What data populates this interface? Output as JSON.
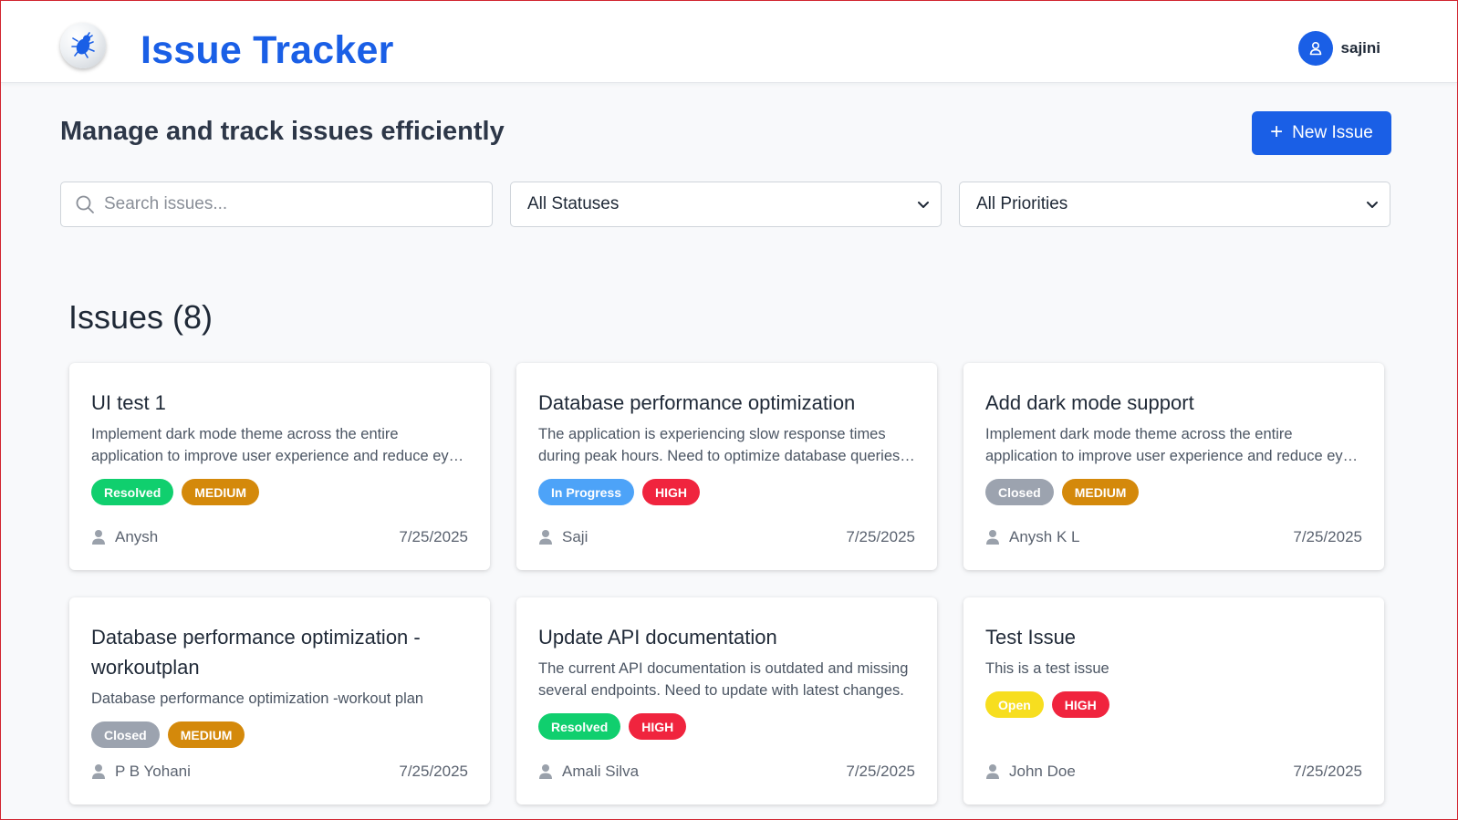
{
  "header": {
    "title": "Issue Tracker",
    "username": "sajini"
  },
  "toolbar": {
    "subtitle": "Manage and track issues efficiently",
    "new_issue_label": "New Issue",
    "search_placeholder": "Search issues...",
    "status_filter": "All Statuses",
    "priority_filter": "All Priorities"
  },
  "issues_heading": "Issues (8)",
  "colors": {
    "accent": "#1a5fe6",
    "resolved": "#10cf6e",
    "in_progress": "#4da3f8",
    "closed": "#9ca3af",
    "open": "#f7de1f",
    "high": "#f0243e",
    "medium": "#d4890b"
  },
  "issues": [
    {
      "title": "UI test 1",
      "description": "Implement dark mode theme across the entire application to improve user experience and reduce eye strain for users.",
      "status": "Resolved",
      "status_color": "#10cf6e",
      "priority": "MEDIUM",
      "priority_color": "#d4890b",
      "assignee": "Anysh",
      "date": "7/25/2025"
    },
    {
      "title": "Database performance optimization",
      "description": "The application is experiencing slow response times during peak hours. Need to optimize database queries and indexes.",
      "status": "In Progress",
      "status_color": "#4da3f8",
      "priority": "HIGH",
      "priority_color": "#f0243e",
      "assignee": "Saji",
      "date": "7/25/2025"
    },
    {
      "title": "Add dark mode support",
      "description": "Implement dark mode theme across the entire application to improve user experience and reduce eye strain for users.",
      "status": "Closed",
      "status_color": "#9ca3af",
      "priority": "MEDIUM",
      "priority_color": "#d4890b",
      "assignee": "Anysh K L",
      "date": "7/25/2025"
    },
    {
      "title": "Database performance optimization - workoutplan",
      "description": "Database performance optimization -workout plan",
      "status": "Closed",
      "status_color": "#9ca3af",
      "priority": "MEDIUM",
      "priority_color": "#d4890b",
      "assignee": "P B Yohani",
      "date": "7/25/2025"
    },
    {
      "title": "Update API documentation",
      "description": "The current API documentation is outdated and missing several endpoints. Need to update with latest changes.",
      "status": "Resolved",
      "status_color": "#10cf6e",
      "priority": "HIGH",
      "priority_color": "#f0243e",
      "assignee": "Amali Silva",
      "date": "7/25/2025"
    },
    {
      "title": "Test Issue",
      "description": "This is a test issue",
      "status": "Open",
      "status_color": "#f7de1f",
      "priority": "HIGH",
      "priority_color": "#f0243e",
      "assignee": "John Doe",
      "date": "7/25/2025"
    }
  ]
}
